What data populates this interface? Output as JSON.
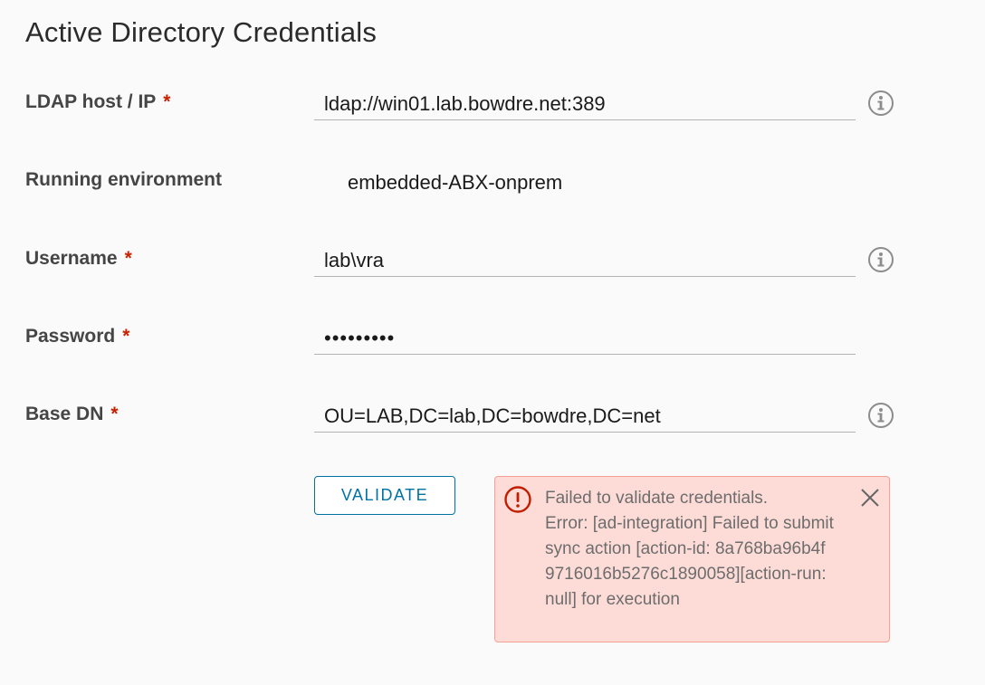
{
  "page": {
    "title": "Active Directory Credentials"
  },
  "fields": {
    "ldap_host": {
      "label": "LDAP host / IP",
      "required_mark": "*",
      "value": "ldap://win01.lab.bowdre.net:389",
      "icon": "info-icon"
    },
    "running_environment": {
      "label": "Running environment",
      "value": "embedded-ABX-onprem"
    },
    "username": {
      "label": "Username",
      "required_mark": "*",
      "value": "lab\\vra",
      "icon": "info-icon"
    },
    "password": {
      "label": "Password",
      "required_mark": "*",
      "value": "•••••••••"
    },
    "base_dn": {
      "label": "Base DN",
      "required_mark": "*",
      "value": "OU=LAB,DC=lab,DC=bowdre,DC=net",
      "icon": "info-icon"
    }
  },
  "actions": {
    "validate_label": "VALIDATE"
  },
  "alert": {
    "type": "error",
    "icon": "error-circle-icon",
    "message": "Failed to validate credentials.\nError: [ad-integration] Failed to submit sync action [action-id: 8a768ba96b4f9716016b5276c1890058][action-run: null] for execution",
    "close_icon": "close-icon"
  },
  "colors": {
    "required": "#c92100",
    "accent": "#0072a3",
    "alert_background": "#fddcd8",
    "alert_border": "#f5a093",
    "alert_icon": "#c21d00"
  }
}
